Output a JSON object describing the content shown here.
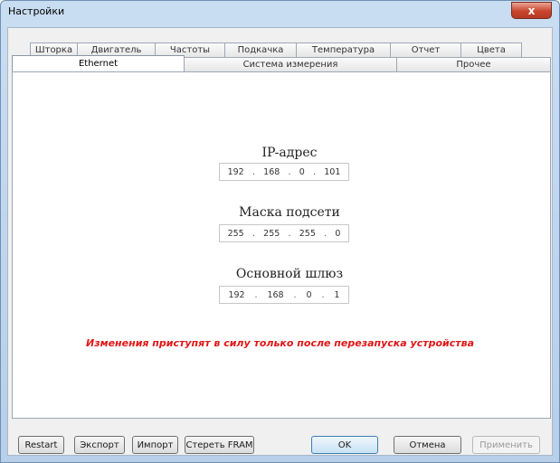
{
  "window": {
    "title": "Настройки",
    "close_glyph": "x"
  },
  "tabs_top": [
    "Шторка",
    "Двигатель",
    "Частоты",
    "Подкачка",
    "Температура",
    "Отчет",
    "Цвета"
  ],
  "tabs_bottom": [
    "Ethernet",
    "Система измерения",
    "Прочее"
  ],
  "active_tab": "Ethernet",
  "fields": {
    "ip": {
      "label": "IP-адрес",
      "octets": [
        "192",
        "168",
        "0",
        "101"
      ]
    },
    "mask": {
      "label": "Маска подсети",
      "octets": [
        "255",
        "255",
        "255",
        "0"
      ]
    },
    "gateway": {
      "label": "Основной шлюз",
      "octets": [
        "192",
        "168",
        "0",
        "1"
      ]
    }
  },
  "warning": "Изменения приступят в силу только после перезапуска устройства",
  "buttons": {
    "restart": "Restart",
    "export": "Экспорт",
    "import": "Импорт",
    "erase_fram": "Стереть FRAM",
    "ok": "OK",
    "cancel": "Отмена",
    "apply": "Применить"
  },
  "colors": {
    "warning": "#e01616",
    "titlebar": "#c9ddf2"
  }
}
